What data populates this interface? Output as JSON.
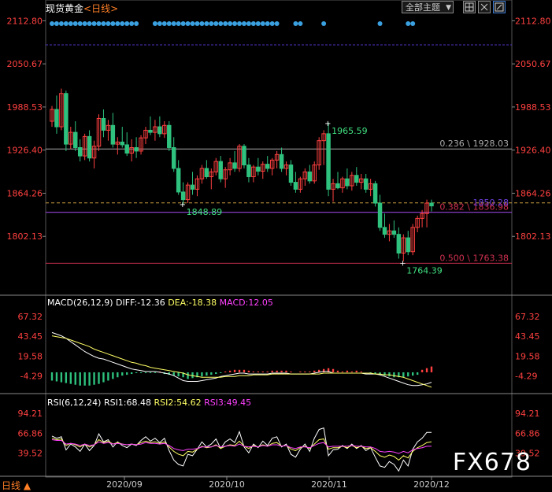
{
  "header": {
    "instrument": "现货黄金",
    "period_open": "<",
    "period": "日线",
    "period_close": ">",
    "theme_button": "全部主题",
    "dropdown_icon": "chevron-down-icon",
    "buttons": [
      "grid-icon",
      "close-icon",
      "maximize-icon"
    ]
  },
  "bottom_left": "日线",
  "bottom_left_arrow": "▲",
  "watermark": "FX678",
  "colors": {
    "up": "#ff4040",
    "down": "#2ec27e",
    "fib": "#d03050",
    "price_ref": "#7040e0",
    "dots": "#3aa0e0",
    "dif": "#ffffff",
    "dea": "#ffff66",
    "macd_label": "#ff40ff",
    "rsi1": "#ffffff",
    "rsi2": "#ffff66",
    "rsi3": "#ff40ff"
  },
  "chart_data": [
    {
      "type": "candlestick",
      "y_ticks": [
        "2112.80",
        "2050.67",
        "1988.53",
        "1926.40",
        "1864.26",
        "1802.13"
      ],
      "ylim": [
        1740,
        2120
      ],
      "x_ticks": [
        "2020/09",
        "2020/10",
        "2020/11",
        "2020/12"
      ],
      "annotations": [
        {
          "text": "1965.59",
          "value": 1965.59
        },
        {
          "text": "1848.89",
          "value": 1848.89
        },
        {
          "text": "1764.39",
          "value": 1764.39
        }
      ],
      "fib_levels": [
        {
          "label": "0.236 \\ 1928.03",
          "value": 1928.03
        },
        {
          "label": "0.382 \\ 1836.98",
          "value": 1836.98
        },
        {
          "label": "0.500 \\ 1763.38",
          "value": 1763.38
        }
      ],
      "current_price": {
        "label": "1850.28",
        "value": 1850.28
      },
      "ohlc": [
        [
          1968,
          1990,
          1960,
          1985
        ],
        [
          1985,
          2005,
          1950,
          1960
        ],
        [
          1960,
          2015,
          1955,
          2008
        ],
        [
          2008,
          2012,
          1925,
          1935
        ],
        [
          1935,
          1960,
          1928,
          1952
        ],
        [
          1952,
          1968,
          1925,
          1930
        ],
        [
          1930,
          1942,
          1910,
          1918
        ],
        [
          1918,
          1950,
          1912,
          1946
        ],
        [
          1946,
          1955,
          1910,
          1915
        ],
        [
          1915,
          1940,
          1900,
          1932
        ],
        [
          1932,
          1978,
          1925,
          1972
        ],
        [
          1972,
          1985,
          1945,
          1955
        ],
        [
          1955,
          1970,
          1940,
          1962
        ],
        [
          1962,
          1980,
          1930,
          1935
        ],
        [
          1935,
          1945,
          1920,
          1938
        ],
        [
          1938,
          1960,
          1930,
          1934
        ],
        [
          1934,
          1952,
          1918,
          1922
        ],
        [
          1922,
          1942,
          1910,
          1930
        ],
        [
          1930,
          1945,
          1915,
          1925
        ],
        [
          1925,
          1948,
          1920,
          1944
        ],
        [
          1944,
          1960,
          1935,
          1955
        ],
        [
          1955,
          1975,
          1948,
          1952
        ],
        [
          1952,
          1970,
          1940,
          1960
        ],
        [
          1960,
          1975,
          1945,
          1950
        ],
        [
          1950,
          1968,
          1944,
          1962
        ],
        [
          1962,
          1968,
          1925,
          1930
        ],
        [
          1930,
          1945,
          1895,
          1900
        ],
        [
          1900,
          1912,
          1862,
          1866
        ],
        [
          1866,
          1880,
          1848,
          1855
        ],
        [
          1855,
          1880,
          1850,
          1876
        ],
        [
          1876,
          1895,
          1862,
          1870
        ],
        [
          1870,
          1890,
          1860,
          1885
        ],
        [
          1885,
          1905,
          1878,
          1900
        ],
        [
          1900,
          1912,
          1885,
          1888
        ],
        [
          1888,
          1900,
          1870,
          1895
        ],
        [
          1895,
          1915,
          1890,
          1910
        ],
        [
          1910,
          1918,
          1880,
          1885
        ],
        [
          1885,
          1902,
          1872,
          1898
        ],
        [
          1898,
          1915,
          1890,
          1908
        ],
        [
          1908,
          1925,
          1895,
          1900
        ],
        [
          1900,
          1935,
          1895,
          1932
        ],
        [
          1932,
          1935,
          1900,
          1905
        ],
        [
          1905,
          1915,
          1880,
          1888
        ],
        [
          1888,
          1905,
          1880,
          1902
        ],
        [
          1902,
          1915,
          1890,
          1896
        ],
        [
          1896,
          1910,
          1885,
          1906
        ],
        [
          1906,
          1918,
          1895,
          1900
        ],
        [
          1900,
          1915,
          1890,
          1912
        ],
        [
          1912,
          1925,
          1900,
          1920
        ],
        [
          1920,
          1930,
          1895,
          1900
        ],
        [
          1900,
          1910,
          1890,
          1905
        ],
        [
          1905,
          1912,
          1875,
          1880
        ],
        [
          1880,
          1895,
          1865,
          1870
        ],
        [
          1870,
          1888,
          1865,
          1885
        ],
        [
          1885,
          1900,
          1875,
          1895
        ],
        [
          1895,
          1905,
          1878,
          1882
        ],
        [
          1882,
          1910,
          1878,
          1905
        ],
        [
          1905,
          1945,
          1898,
          1940
        ],
        [
          1940,
          1955,
          1905,
          1950
        ],
        [
          1950,
          1966,
          1860,
          1870
        ],
        [
          1870,
          1885,
          1852,
          1878
        ],
        [
          1878,
          1895,
          1870,
          1872
        ],
        [
          1872,
          1888,
          1865,
          1885
        ],
        [
          1885,
          1900,
          1870,
          1875
        ],
        [
          1875,
          1895,
          1868,
          1890
        ],
        [
          1890,
          1902,
          1875,
          1880
        ],
        [
          1880,
          1892,
          1870,
          1885
        ],
        [
          1885,
          1892,
          1865,
          1870
        ],
        [
          1870,
          1885,
          1860,
          1878
        ],
        [
          1878,
          1882,
          1845,
          1850
        ],
        [
          1850,
          1862,
          1810,
          1815
        ],
        [
          1815,
          1835,
          1800,
          1805
        ],
        [
          1805,
          1820,
          1795,
          1810
        ],
        [
          1810,
          1825,
          1800,
          1805
        ],
        [
          1805,
          1815,
          1770,
          1778
        ],
        [
          1778,
          1805,
          1766,
          1800
        ],
        [
          1800,
          1810,
          1775,
          1780
        ],
        [
          1780,
          1820,
          1775,
          1815
        ],
        [
          1815,
          1832,
          1808,
          1828
        ],
        [
          1828,
          1840,
          1815,
          1835
        ],
        [
          1835,
          1855,
          1815,
          1850
        ],
        [
          1850,
          1855,
          1838,
          1846
        ]
      ]
    },
    {
      "type": "macd",
      "title": "MACD(26,12,9)",
      "legend": {
        "dif_label": "DIFF:",
        "dif_value": "-12.36",
        "dea_label": "DEA:",
        "dea_value": "-18.38",
        "macd_label": "MACD:",
        "macd_value": "12.05"
      },
      "y_ticks": [
        "67.32",
        "43.45",
        "19.58",
        "-4.29"
      ],
      "ylim": [
        -20,
        75
      ],
      "dif": [
        48,
        46,
        44,
        41,
        37,
        33,
        29,
        25,
        22,
        19,
        17,
        16,
        14,
        12,
        10,
        8,
        6,
        4,
        3,
        2,
        1,
        1,
        1,
        0,
        -1,
        -2,
        -4,
        -7,
        -10,
        -11,
        -11,
        -11,
        -10,
        -9,
        -8,
        -7,
        -5,
        -4,
        -3,
        -2,
        -1,
        -1,
        -2,
        -2,
        -2,
        -2,
        -2,
        -1,
        -1,
        -1,
        -1,
        -2,
        -2,
        -2,
        -2,
        -2,
        -1,
        0,
        1,
        1,
        -1,
        -1,
        -1,
        -1,
        -1,
        -1,
        -1,
        -2,
        -2,
        -2,
        -3,
        -5,
        -7,
        -9,
        -11,
        -13,
        -15,
        -16,
        -16,
        -15,
        -14,
        -12
      ],
      "dea": [
        44,
        43,
        42,
        41,
        39,
        37,
        35,
        33,
        31,
        28,
        26,
        24,
        22,
        20,
        18,
        16,
        14,
        12,
        11,
        9,
        8,
        6,
        5,
        4,
        3,
        2,
        1,
        0,
        -1,
        -3,
        -4,
        -5,
        -6,
        -6,
        -6,
        -6,
        -6,
        -5,
        -5,
        -5,
        -4,
        -4,
        -4,
        -3,
        -3,
        -3,
        -3,
        -2,
        -2,
        -2,
        -2,
        -2,
        -2,
        -2,
        -2,
        -2,
        -2,
        -2,
        -1,
        -1,
        -1,
        -1,
        -1,
        -1,
        -1,
        -1,
        -1,
        -1,
        -1,
        -2,
        -2,
        -3,
        -3,
        -4,
        -5,
        -6,
        -8,
        -10,
        -12,
        -14,
        -16,
        -18
      ],
      "hist": [
        -10,
        -11,
        -12,
        -13,
        -14,
        -15,
        -16,
        -16,
        -16,
        -15,
        -14,
        -12,
        -10,
        -8,
        -6,
        -4,
        -3,
        -2,
        -1,
        -1,
        -1,
        -1,
        -1,
        1,
        -2,
        -3,
        -4,
        -5,
        -6,
        -8,
        -7,
        -6,
        -5,
        -4,
        -3,
        -2,
        -1,
        1,
        2,
        3,
        3,
        3,
        2,
        1,
        1,
        1,
        1,
        2,
        2,
        2,
        2,
        1,
        0,
        1,
        1,
        1,
        2,
        3,
        4,
        5,
        4,
        2,
        1,
        2,
        1,
        2,
        1,
        0,
        -1,
        -2,
        -3,
        -4,
        -5,
        -6,
        -6,
        -6,
        -5,
        -4,
        -3,
        3,
        5,
        7
      ]
    },
    {
      "type": "rsi",
      "title": "RSI(6,12,24)",
      "legend": {
        "rsi1_label": "RSI1:",
        "rsi1_value": "68.48",
        "rsi2_label": "RSI2:",
        "rsi2_value": "54.62",
        "rsi3_label": "RSI3:",
        "rsi3_value": "49.45"
      },
      "y_ticks": [
        "94.21",
        "66.86",
        "39.52"
      ],
      "ylim": [
        10,
        105
      ],
      "rsi1": [
        63,
        60,
        62,
        44,
        52,
        48,
        42,
        52,
        43,
        50,
        66,
        55,
        58,
        48,
        55,
        50,
        47,
        52,
        50,
        57,
        62,
        56,
        60,
        54,
        60,
        43,
        30,
        24,
        22,
        38,
        36,
        45,
        55,
        48,
        52,
        59,
        46,
        55,
        59,
        54,
        69,
        48,
        40,
        52,
        47,
        56,
        50,
        60,
        62,
        48,
        52,
        38,
        34,
        45,
        52,
        42,
        60,
        72,
        74,
        36,
        44,
        45,
        50,
        46,
        52,
        46,
        50,
        43,
        47,
        34,
        22,
        20,
        28,
        24,
        15,
        30,
        22,
        45,
        55,
        60,
        68,
        68
      ],
      "rsi2": [
        60,
        58,
        59,
        50,
        53,
        51,
        48,
        52,
        48,
        51,
        58,
        54,
        56,
        52,
        54,
        52,
        51,
        52,
        51,
        54,
        56,
        54,
        55,
        53,
        55,
        48,
        42,
        38,
        36,
        42,
        41,
        45,
        49,
        47,
        48,
        51,
        46,
        49,
        51,
        50,
        56,
        49,
        46,
        50,
        48,
        51,
        49,
        53,
        54,
        49,
        50,
        45,
        43,
        47,
        49,
        46,
        52,
        58,
        59,
        45,
        47,
        47,
        49,
        47,
        50,
        47,
        49,
        46,
        47,
        42,
        36,
        34,
        37,
        35,
        30,
        36,
        33,
        42,
        47,
        50,
        54,
        55
      ],
      "rsi3": [
        58,
        57,
        57,
        52,
        53,
        52,
        50,
        52,
        50,
        51,
        55,
        53,
        54,
        52,
        53,
        52,
        51,
        52,
        51,
        52,
        54,
        53,
        53,
        52,
        53,
        50,
        46,
        44,
        43,
        45,
        45,
        46,
        48,
        48,
        48,
        50,
        48,
        49,
        50,
        49,
        52,
        49,
        48,
        49,
        48,
        50,
        49,
        51,
        51,
        49,
        50,
        47,
        46,
        48,
        48,
        47,
        50,
        53,
        54,
        48,
        49,
        49,
        49,
        49,
        50,
        49,
        49,
        48,
        48,
        46,
        42,
        41,
        42,
        41,
        39,
        42,
        40,
        44,
        46,
        47,
        49,
        49
      ]
    }
  ]
}
